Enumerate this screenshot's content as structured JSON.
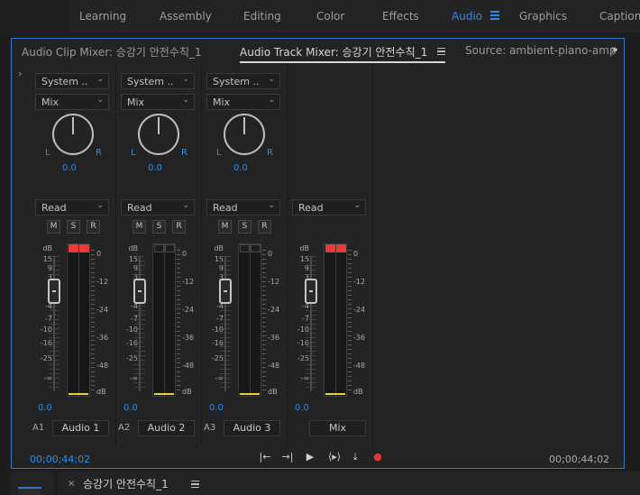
{
  "workspaces": {
    "tabs": [
      {
        "label": "Learning"
      },
      {
        "label": "Assembly"
      },
      {
        "label": "Editing"
      },
      {
        "label": "Color"
      },
      {
        "label": "Effects"
      },
      {
        "label": "Audio",
        "active": true
      },
      {
        "label": "Graphics"
      },
      {
        "label": "Captions"
      }
    ],
    "menu_icon": "hamburger-icon",
    "accent_color": "#2d8ceb"
  },
  "panel": {
    "tabs": [
      {
        "label": "Audio Clip Mixer: 승강기 안전수칙_1"
      },
      {
        "label": "Audio Track Mixer: 승강기 안전수칙_1",
        "active": true
      },
      {
        "label": "Source: ambient-piano-amp"
      }
    ],
    "overflow_icon": "double-chevron-right-icon",
    "expand_icon": "chevron-right-icon"
  },
  "tracks": [
    {
      "input": "System ..",
      "effect": "Mix",
      "pan": "0.0",
      "pan_left": "L",
      "pan_right": "R",
      "automation": "Read",
      "mute": "M",
      "solo": "S",
      "record": "R",
      "volume": "0.0",
      "id": "A1",
      "name": "Audio 1",
      "peak_color": "#e83a3a",
      "peak_on": true,
      "has_controls": true
    },
    {
      "input": "System ..",
      "effect": "Mix",
      "pan": "0.0",
      "pan_left": "L",
      "pan_right": "R",
      "automation": "Read",
      "mute": "M",
      "solo": "S",
      "record": "R",
      "volume": "0.0",
      "id": "A2",
      "name": "Audio 2",
      "peak_color": "#1e1e1e",
      "peak_on": false,
      "has_controls": true
    },
    {
      "input": "System ..",
      "effect": "Mix",
      "pan": "0.0",
      "pan_left": "L",
      "pan_right": "R",
      "automation": "Read",
      "mute": "M",
      "solo": "S",
      "record": "R",
      "volume": "0.0",
      "id": "A3",
      "name": "Audio 3",
      "peak_color": "#1e1e1e",
      "peak_on": false,
      "has_controls": true
    },
    {
      "automation": "Read",
      "volume": "0.0",
      "id": "",
      "name": "Mix",
      "peak_color": "#e83a3a",
      "peak_on": true,
      "has_controls": false
    }
  ],
  "fader_scale": [
    "dB",
    "15",
    "9",
    "3",
    "0",
    "-4",
    "-7",
    "-10",
    "-16",
    "-25",
    "-∞"
  ],
  "meter_scale": [
    "0",
    "-12",
    "-24",
    "-36",
    "-48",
    "dB"
  ],
  "transport": {
    "timecode_in": "00;00;44;02",
    "timecode_out": "00;00;44;02",
    "buttons": [
      {
        "name": "go-to-in-icon",
        "glyph": "{←"
      },
      {
        "name": "go-to-out-icon",
        "glyph": "→}"
      },
      {
        "name": "play-icon",
        "glyph": "▶"
      },
      {
        "name": "loop-icon",
        "glyph": "{▸}"
      },
      {
        "name": "export-icon",
        "glyph": "⬓"
      },
      {
        "name": "record-icon",
        "glyph": "●"
      }
    ],
    "record_color": "#e0383a"
  },
  "timeline": {
    "title": "승강기 안전수칙_1",
    "close_label": "×",
    "menu_icon": "hamburger-icon"
  }
}
